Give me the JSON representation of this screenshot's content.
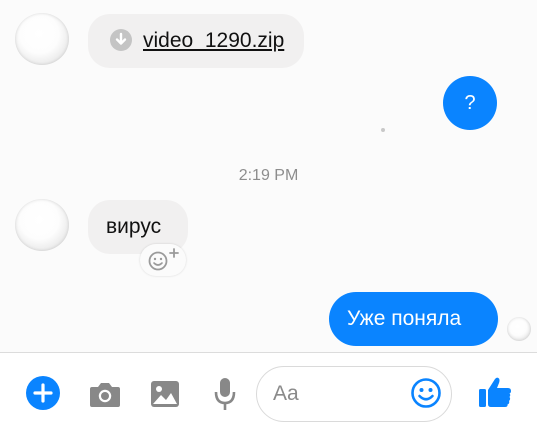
{
  "conversation": {
    "messages": [
      {
        "type": "file",
        "direction": "incoming",
        "file_name": "video_1290.zip",
        "icon": "download-icon"
      },
      {
        "type": "text",
        "direction": "outgoing",
        "text": "?"
      },
      {
        "type": "text",
        "direction": "incoming",
        "text": "вирус",
        "reaction_icon": "add-reaction-icon"
      },
      {
        "type": "text",
        "direction": "outgoing",
        "text": "Уже поняла"
      }
    ],
    "timestamp": "2:19 PM"
  },
  "composer": {
    "placeholder": "Aa",
    "icons": [
      "plus-icon",
      "camera-icon",
      "image-icon",
      "mic-icon",
      "emoji-icon",
      "thumbs-up-icon"
    ]
  },
  "colors": {
    "accent": "#0a84ff",
    "incoming_bubble": "#f1f0f0",
    "timestamp": "#8d8d8d"
  }
}
